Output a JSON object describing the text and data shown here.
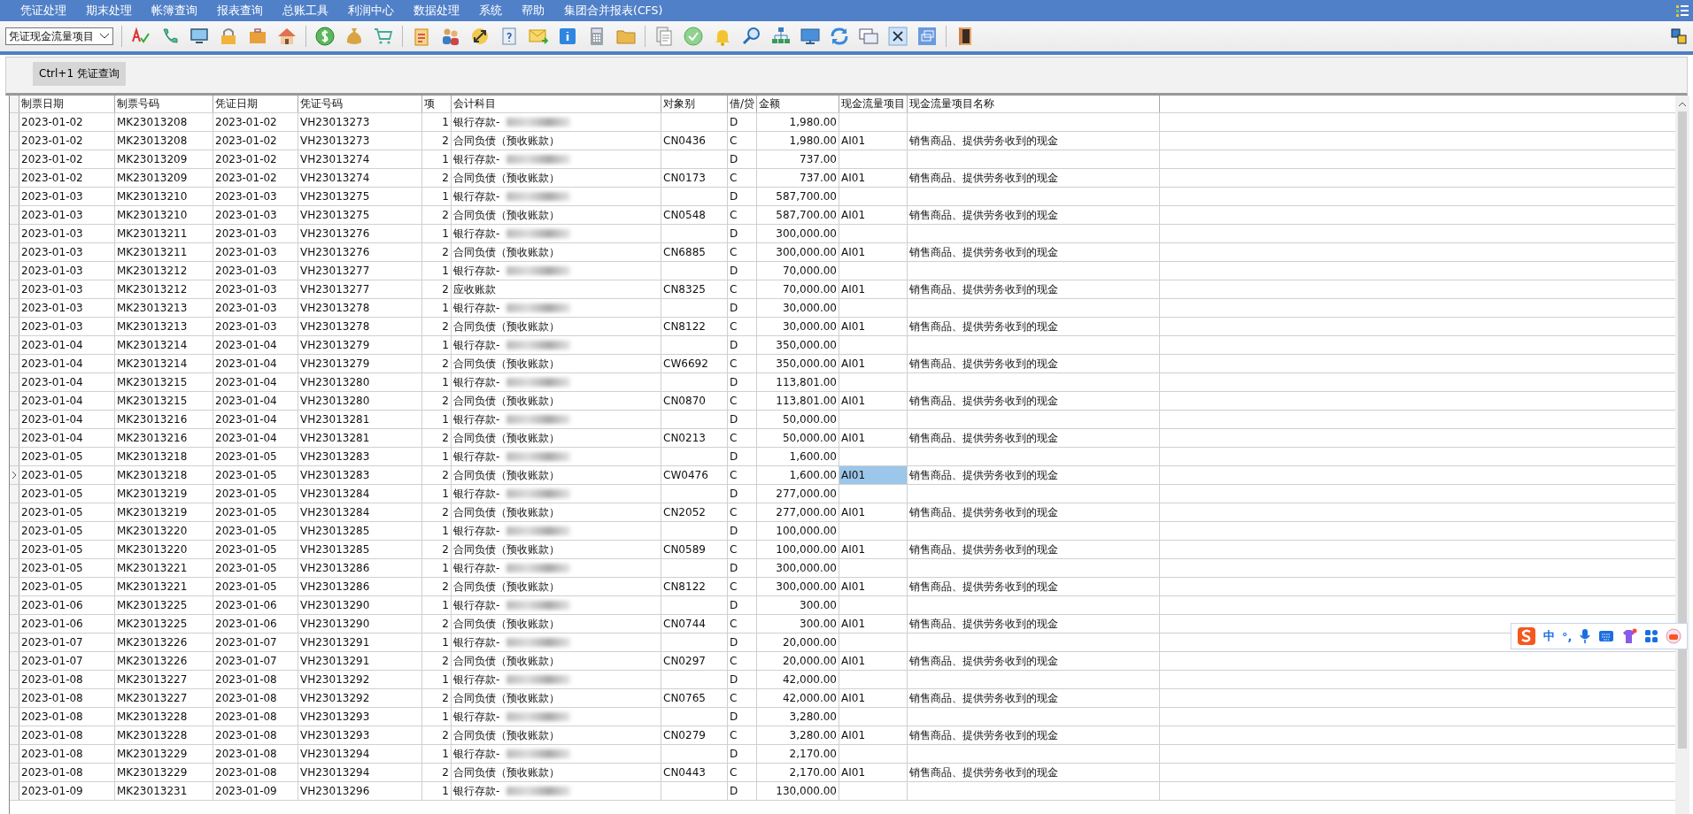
{
  "menu": [
    "凭证处理",
    "期末处理",
    "帐簿查询",
    "报表查询",
    "总账工具",
    "利润中心",
    "数据处理",
    "系统",
    "帮助",
    "集团合并报表(CFS)"
  ],
  "toolbar": {
    "combo_value": "凭证现金流量项目"
  },
  "tabs": [
    {
      "label": "Ctrl+1 凭证查询",
      "selected": true
    }
  ],
  "table": {
    "columns": [
      "制票日期",
      "制票号码",
      "凭证日期",
      "凭证号码",
      "项",
      "会计科目",
      "对象别",
      "借/贷",
      "金额",
      "现金流量项目",
      "现金流量项目名称"
    ],
    "rows": [
      {
        "make_date": "2023-01-02",
        "make_no": "MK23013208",
        "voucher_date": "2023-01-02",
        "voucher_no": "VH23013273",
        "line": "1",
        "account": "银行存款-",
        "redacted": true,
        "dc": "D",
        "amount": "1,980.00",
        "selected": false
      },
      {
        "make_date": "2023-01-02",
        "make_no": "MK23013208",
        "voucher_date": "2023-01-02",
        "voucher_no": "VH23013273",
        "line": "2",
        "account": "合同负债（预收账款）",
        "redacted": false,
        "object": "CN0436",
        "dc": "C",
        "amount": "1,980.00",
        "cf_code": "AI01",
        "cf_name": "销售商品、提供劳务收到的现金",
        "selected": false
      },
      {
        "make_date": "2023-01-02",
        "make_no": "MK23013209",
        "voucher_date": "2023-01-02",
        "voucher_no": "VH23013274",
        "line": "1",
        "account": "银行存款-",
        "redacted": true,
        "dc": "D",
        "amount": "737.00",
        "selected": false
      },
      {
        "make_date": "2023-01-02",
        "make_no": "MK23013209",
        "voucher_date": "2023-01-02",
        "voucher_no": "VH23013274",
        "line": "2",
        "account": "合同负债（预收账款）",
        "redacted": false,
        "object": "CN0173",
        "dc": "C",
        "amount": "737.00",
        "cf_code": "AI01",
        "cf_name": "销售商品、提供劳务收到的现金",
        "selected": false
      },
      {
        "make_date": "2023-01-03",
        "make_no": "MK23013210",
        "voucher_date": "2023-01-03",
        "voucher_no": "VH23013275",
        "line": "1",
        "account": "银行存款-",
        "redacted": true,
        "dc": "D",
        "amount": "587,700.00",
        "selected": false
      },
      {
        "make_date": "2023-01-03",
        "make_no": "MK23013210",
        "voucher_date": "2023-01-03",
        "voucher_no": "VH23013275",
        "line": "2",
        "account": "合同负债（预收账款）",
        "redacted": false,
        "object": "CN0548",
        "dc": "C",
        "amount": "587,700.00",
        "cf_code": "AI01",
        "cf_name": "销售商品、提供劳务收到的现金",
        "selected": false
      },
      {
        "make_date": "2023-01-03",
        "make_no": "MK23013211",
        "voucher_date": "2023-01-03",
        "voucher_no": "VH23013276",
        "line": "1",
        "account": "银行存款-",
        "redacted": true,
        "dc": "D",
        "amount": "300,000.00",
        "selected": false
      },
      {
        "make_date": "2023-01-03",
        "make_no": "MK23013211",
        "voucher_date": "2023-01-03",
        "voucher_no": "VH23013276",
        "line": "2",
        "account": "合同负债（预收账款）",
        "redacted": false,
        "object": "CN6885",
        "dc": "C",
        "amount": "300,000.00",
        "cf_code": "AI01",
        "cf_name": "销售商品、提供劳务收到的现金",
        "selected": false
      },
      {
        "make_date": "2023-01-03",
        "make_no": "MK23013212",
        "voucher_date": "2023-01-03",
        "voucher_no": "VH23013277",
        "line": "1",
        "account": "银行存款-",
        "redacted": true,
        "dc": "D",
        "amount": "70,000.00",
        "selected": false
      },
      {
        "make_date": "2023-01-03",
        "make_no": "MK23013212",
        "voucher_date": "2023-01-03",
        "voucher_no": "VH23013277",
        "line": "2",
        "account": "应收账款",
        "redacted": false,
        "object": "CN8325",
        "dc": "C",
        "amount": "70,000.00",
        "cf_code": "AI01",
        "cf_name": "销售商品、提供劳务收到的现金",
        "selected": false
      },
      {
        "make_date": "2023-01-03",
        "make_no": "MK23013213",
        "voucher_date": "2023-01-03",
        "voucher_no": "VH23013278",
        "line": "1",
        "account": "银行存款-",
        "redacted": true,
        "dc": "D",
        "amount": "30,000.00",
        "selected": false
      },
      {
        "make_date": "2023-01-03",
        "make_no": "MK23013213",
        "voucher_date": "2023-01-03",
        "voucher_no": "VH23013278",
        "line": "2",
        "account": "合同负债（预收账款）",
        "redacted": false,
        "object": "CN8122",
        "dc": "C",
        "amount": "30,000.00",
        "cf_code": "AI01",
        "cf_name": "销售商品、提供劳务收到的现金",
        "selected": false
      },
      {
        "make_date": "2023-01-04",
        "make_no": "MK23013214",
        "voucher_date": "2023-01-04",
        "voucher_no": "VH23013279",
        "line": "1",
        "account": "银行存款-",
        "redacted": true,
        "dc": "D",
        "amount": "350,000.00",
        "selected": false
      },
      {
        "make_date": "2023-01-04",
        "make_no": "MK23013214",
        "voucher_date": "2023-01-04",
        "voucher_no": "VH23013279",
        "line": "2",
        "account": "合同负债（预收账款）",
        "redacted": false,
        "object": "CW6692",
        "dc": "C",
        "amount": "350,000.00",
        "cf_code": "AI01",
        "cf_name": "销售商品、提供劳务收到的现金",
        "selected": false
      },
      {
        "make_date": "2023-01-04",
        "make_no": "MK23013215",
        "voucher_date": "2023-01-04",
        "voucher_no": "VH23013280",
        "line": "1",
        "account": "银行存款-",
        "redacted": true,
        "dc": "D",
        "amount": "113,801.00",
        "selected": false
      },
      {
        "make_date": "2023-01-04",
        "make_no": "MK23013215",
        "voucher_date": "2023-01-04",
        "voucher_no": "VH23013280",
        "line": "2",
        "account": "合同负债（预收账款）",
        "redacted": false,
        "object": "CN0870",
        "dc": "C",
        "amount": "113,801.00",
        "cf_code": "AI01",
        "cf_name": "销售商品、提供劳务收到的现金",
        "selected": false
      },
      {
        "make_date": "2023-01-04",
        "make_no": "MK23013216",
        "voucher_date": "2023-01-04",
        "voucher_no": "VH23013281",
        "line": "1",
        "account": "银行存款-",
        "redacted": true,
        "dc": "D",
        "amount": "50,000.00",
        "selected": false
      },
      {
        "make_date": "2023-01-04",
        "make_no": "MK23013216",
        "voucher_date": "2023-01-04",
        "voucher_no": "VH23013281",
        "line": "2",
        "account": "合同负债（预收账款）",
        "redacted": false,
        "object": "CN0213",
        "dc": "C",
        "amount": "50,000.00",
        "cf_code": "AI01",
        "cf_name": "销售商品、提供劳务收到的现金",
        "selected": false
      },
      {
        "make_date": "2023-01-05",
        "make_no": "MK23013218",
        "voucher_date": "2023-01-05",
        "voucher_no": "VH23013283",
        "line": "1",
        "account": "银行存款-",
        "redacted": true,
        "dc": "D",
        "amount": "1,600.00",
        "selected": false
      },
      {
        "make_date": "2023-01-05",
        "make_no": "MK23013218",
        "voucher_date": "2023-01-05",
        "voucher_no": "VH23013283",
        "line": "2",
        "account": "合同负债（预收账款）",
        "redacted": false,
        "object": "CW0476",
        "dc": "C",
        "amount": "1,600.00",
        "cf_code": "AI01",
        "cf_name": "销售商品、提供劳务收到的现金",
        "selected": true
      },
      {
        "make_date": "2023-01-05",
        "make_no": "MK23013219",
        "voucher_date": "2023-01-05",
        "voucher_no": "VH23013284",
        "line": "1",
        "account": "银行存款-",
        "redacted": true,
        "dc": "D",
        "amount": "277,000.00",
        "selected": false
      },
      {
        "make_date": "2023-01-05",
        "make_no": "MK23013219",
        "voucher_date": "2023-01-05",
        "voucher_no": "VH23013284",
        "line": "2",
        "account": "合同负债（预收账款）",
        "redacted": false,
        "object": "CN2052",
        "dc": "C",
        "amount": "277,000.00",
        "cf_code": "AI01",
        "cf_name": "销售商品、提供劳务收到的现金",
        "selected": false
      },
      {
        "make_date": "2023-01-05",
        "make_no": "MK23013220",
        "voucher_date": "2023-01-05",
        "voucher_no": "VH23013285",
        "line": "1",
        "account": "银行存款-",
        "redacted": true,
        "dc": "D",
        "amount": "100,000.00",
        "selected": false
      },
      {
        "make_date": "2023-01-05",
        "make_no": "MK23013220",
        "voucher_date": "2023-01-05",
        "voucher_no": "VH23013285",
        "line": "2",
        "account": "合同负债（预收账款）",
        "redacted": false,
        "object": "CN0589",
        "dc": "C",
        "amount": "100,000.00",
        "cf_code": "AI01",
        "cf_name": "销售商品、提供劳务收到的现金",
        "selected": false
      },
      {
        "make_date": "2023-01-05",
        "make_no": "MK23013221",
        "voucher_date": "2023-01-05",
        "voucher_no": "VH23013286",
        "line": "1",
        "account": "银行存款-",
        "redacted": true,
        "dc": "D",
        "amount": "300,000.00",
        "selected": false
      },
      {
        "make_date": "2023-01-05",
        "make_no": "MK23013221",
        "voucher_date": "2023-01-05",
        "voucher_no": "VH23013286",
        "line": "2",
        "account": "合同负债（预收账款）",
        "redacted": false,
        "object": "CN8122",
        "dc": "C",
        "amount": "300,000.00",
        "cf_code": "AI01",
        "cf_name": "销售商品、提供劳务收到的现金",
        "selected": false
      },
      {
        "make_date": "2023-01-06",
        "make_no": "MK23013225",
        "voucher_date": "2023-01-06",
        "voucher_no": "VH23013290",
        "line": "1",
        "account": "银行存款-",
        "redacted": true,
        "dc": "D",
        "amount": "300.00",
        "selected": false
      },
      {
        "make_date": "2023-01-06",
        "make_no": "MK23013225",
        "voucher_date": "2023-01-06",
        "voucher_no": "VH23013290",
        "line": "2",
        "account": "合同负债（预收账款）",
        "redacted": false,
        "object": "CN0744",
        "dc": "C",
        "amount": "300.00",
        "cf_code": "AI01",
        "cf_name": "销售商品、提供劳务收到的现金",
        "selected": false
      },
      {
        "make_date": "2023-01-07",
        "make_no": "MK23013226",
        "voucher_date": "2023-01-07",
        "voucher_no": "VH23013291",
        "line": "1",
        "account": "银行存款-",
        "redacted": true,
        "dc": "D",
        "amount": "20,000.00",
        "selected": false
      },
      {
        "make_date": "2023-01-07",
        "make_no": "MK23013226",
        "voucher_date": "2023-01-07",
        "voucher_no": "VH23013291",
        "line": "2",
        "account": "合同负债（预收账款）",
        "redacted": false,
        "object": "CN0297",
        "dc": "C",
        "amount": "20,000.00",
        "cf_code": "AI01",
        "cf_name": "销售商品、提供劳务收到的现金",
        "selected": false
      },
      {
        "make_date": "2023-01-08",
        "make_no": "MK23013227",
        "voucher_date": "2023-01-08",
        "voucher_no": "VH23013292",
        "line": "1",
        "account": "银行存款-",
        "redacted": true,
        "dc": "D",
        "amount": "42,000.00",
        "selected": false
      },
      {
        "make_date": "2023-01-08",
        "make_no": "MK23013227",
        "voucher_date": "2023-01-08",
        "voucher_no": "VH23013292",
        "line": "2",
        "account": "合同负债（预收账款）",
        "redacted": false,
        "object": "CN0765",
        "dc": "C",
        "amount": "42,000.00",
        "cf_code": "AI01",
        "cf_name": "销售商品、提供劳务收到的现金",
        "selected": false
      },
      {
        "make_date": "2023-01-08",
        "make_no": "MK23013228",
        "voucher_date": "2023-01-08",
        "voucher_no": "VH23013293",
        "line": "1",
        "account": "银行存款-",
        "redacted": true,
        "dc": "D",
        "amount": "3,280.00",
        "selected": false
      },
      {
        "make_date": "2023-01-08",
        "make_no": "MK23013228",
        "voucher_date": "2023-01-08",
        "voucher_no": "VH23013293",
        "line": "2",
        "account": "合同负债（预收账款）",
        "redacted": false,
        "object": "CN0279",
        "dc": "C",
        "amount": "3,280.00",
        "cf_code": "AI01",
        "cf_name": "销售商品、提供劳务收到的现金",
        "selected": false
      },
      {
        "make_date": "2023-01-08",
        "make_no": "MK23013229",
        "voucher_date": "2023-01-08",
        "voucher_no": "VH23013294",
        "line": "1",
        "account": "银行存款-",
        "redacted": true,
        "dc": "D",
        "amount": "2,170.00",
        "selected": false
      },
      {
        "make_date": "2023-01-08",
        "make_no": "MK23013229",
        "voucher_date": "2023-01-08",
        "voucher_no": "VH23013294",
        "line": "2",
        "account": "合同负债（预收账款）",
        "redacted": false,
        "object": "CN0443",
        "dc": "C",
        "amount": "2,170.00",
        "cf_code": "AI01",
        "cf_name": "销售商品、提供劳务收到的现金",
        "selected": false
      },
      {
        "make_date": "2023-01-09",
        "make_no": "MK23013231",
        "voucher_date": "2023-01-09",
        "voucher_no": "VH23013296",
        "line": "1",
        "account": "银行存款-",
        "redacted": true,
        "dc": "D",
        "amount": "130,000.00",
        "selected": false
      }
    ]
  },
  "ime_bar": {
    "mode": "中",
    "punctuation": "°,"
  }
}
